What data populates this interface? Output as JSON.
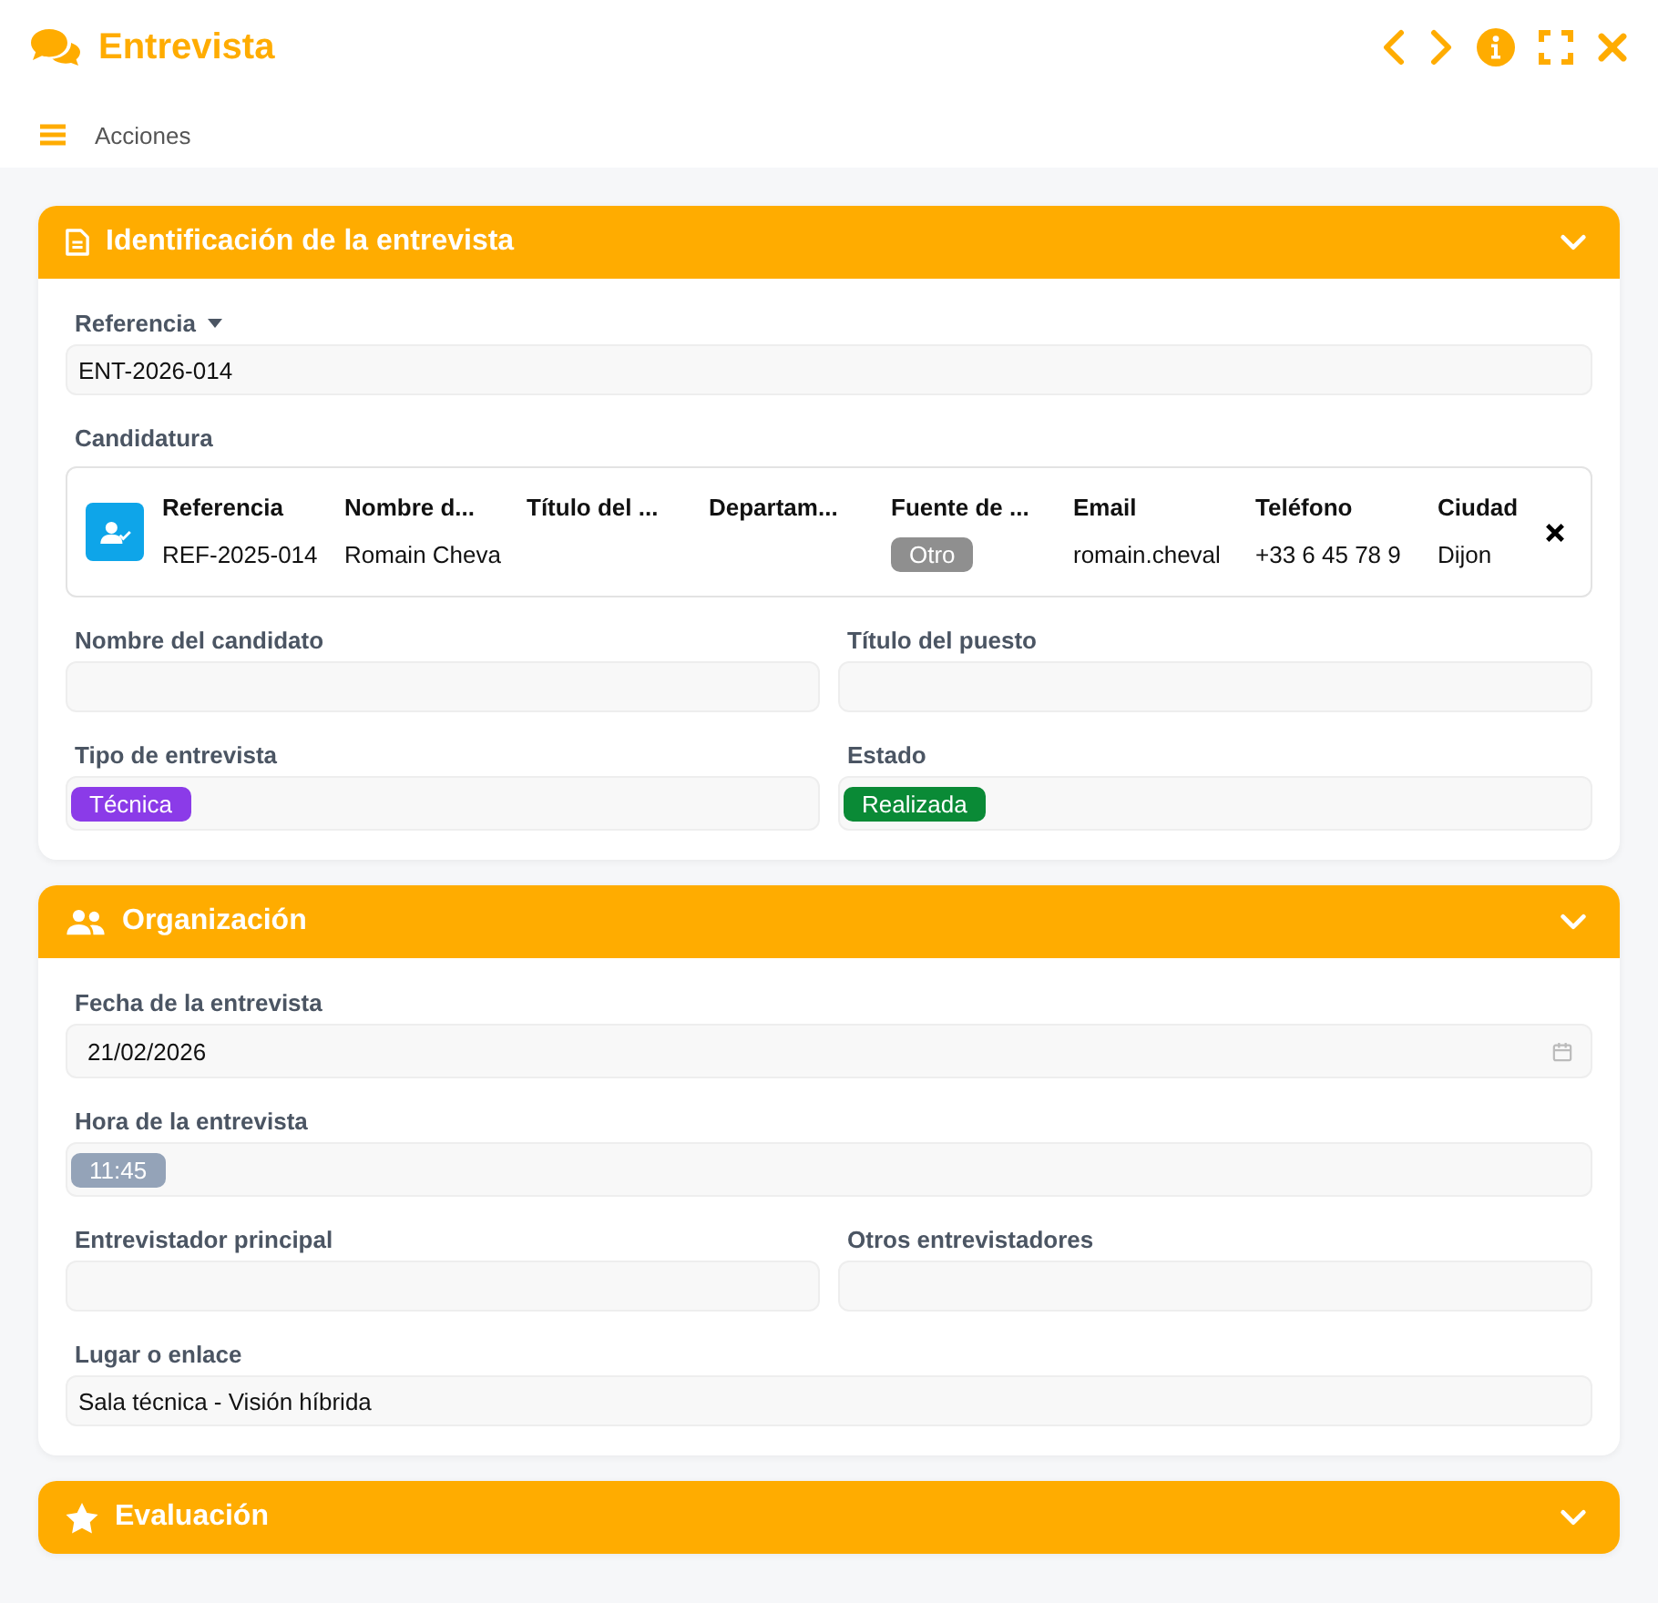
{
  "window": {
    "title": "Entrevista"
  },
  "actions": {
    "label": "Acciones"
  },
  "sections": [
    {
      "title": "Identificación de la entrevista",
      "rows": [
        [
          {
            "kind": "text",
            "label": "Referencia",
            "has_dropdown": true,
            "value": "ENT-2026-014"
          }
        ],
        [
          {
            "kind": "record",
            "label": "Candidatura",
            "columns": [
              "Referencia",
              "Nombre d...",
              "Título del ...",
              "Departam...",
              "Fuente de ...",
              "Email",
              "Teléfono",
              "Ciudad"
            ],
            "cells": [
              {
                "kind": "text",
                "text": "REF-2025-014"
              },
              {
                "kind": "text",
                "text": "Romain Cheva"
              },
              {
                "kind": "text",
                "text": ""
              },
              {
                "kind": "text",
                "text": ""
              },
              {
                "kind": "tag",
                "text": "Otro",
                "color": "#8f8f8f"
              },
              {
                "kind": "text",
                "text": "romain.cheval"
              },
              {
                "kind": "text",
                "text": "+33 6 45 78 9"
              },
              {
                "kind": "text",
                "text": "Dijon"
              }
            ]
          }
        ],
        [
          {
            "kind": "text",
            "label": "Nombre del candidato"
          },
          {
            "kind": "text",
            "label": "Título del puesto"
          }
        ],
        [
          {
            "kind": "tag",
            "label": "Tipo de entrevista",
            "tag": "Técnica",
            "color": "#8b3be8"
          },
          {
            "kind": "tag",
            "label": "Estado",
            "tag": "Realizada",
            "color": "#0a8a36"
          }
        ]
      ]
    },
    {
      "title": "Organización",
      "rows": [
        [
          {
            "kind": "date",
            "label": "Fecha de la entrevista",
            "value": "21/02/2026"
          }
        ],
        [
          {
            "kind": "tag",
            "label": "Hora de la entrevista",
            "tag": "11:45",
            "color": "#94a3b8"
          }
        ],
        [
          {
            "kind": "text",
            "label": "Entrevistador principal"
          },
          {
            "kind": "text",
            "label": "Otros entrevistadores"
          }
        ],
        [
          {
            "kind": "text",
            "label": "Lugar o enlace",
            "value": "Sala técnica - Visión híbrida"
          }
        ]
      ]
    },
    {
      "title": "Evaluación"
    }
  ]
}
